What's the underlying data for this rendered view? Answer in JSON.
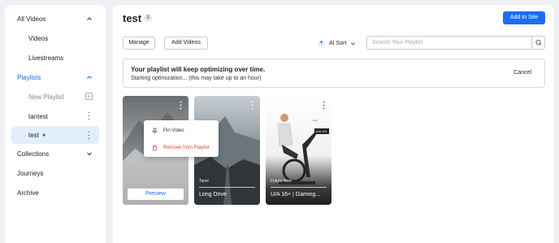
{
  "sidebar": {
    "all_videos": "All Videos",
    "videos": "Videos",
    "livestreams": "Livestreams",
    "playlists": "Playlists",
    "new_playlist": "New Playlist",
    "playlist_items": [
      "tantest",
      "test"
    ],
    "collections": "Collections",
    "journeys": "Journeys",
    "archive": "Archive"
  },
  "header": {
    "title": "test",
    "count": "3",
    "add_to_site": "Add to Site"
  },
  "toolbar": {
    "manage": "Manage",
    "add_videos": "Add Videos",
    "ai_sort": "AI Sort",
    "search_placeholder": "Search Your Playlist"
  },
  "banner": {
    "title": "Your playlist will keep optimizing over time.",
    "subtitle": "Starting optimization... (this may take up to an hour)",
    "cancel": "Cancel"
  },
  "cards": [
    {
      "preview_label": "Preview"
    },
    {
      "meta": "Tanvi",
      "name": "Long Drive"
    },
    {
      "meta": "Future Now",
      "name": "U/A 16+ | Gaming...",
      "tag": "U/A 16+"
    }
  ],
  "context_menu": {
    "pin": "Pin Video",
    "remove": "Remove from Playlist"
  },
  "colors": {
    "accent": "#1a6df0",
    "danger": "#e04040",
    "selected_bg": "#e3eefc"
  }
}
